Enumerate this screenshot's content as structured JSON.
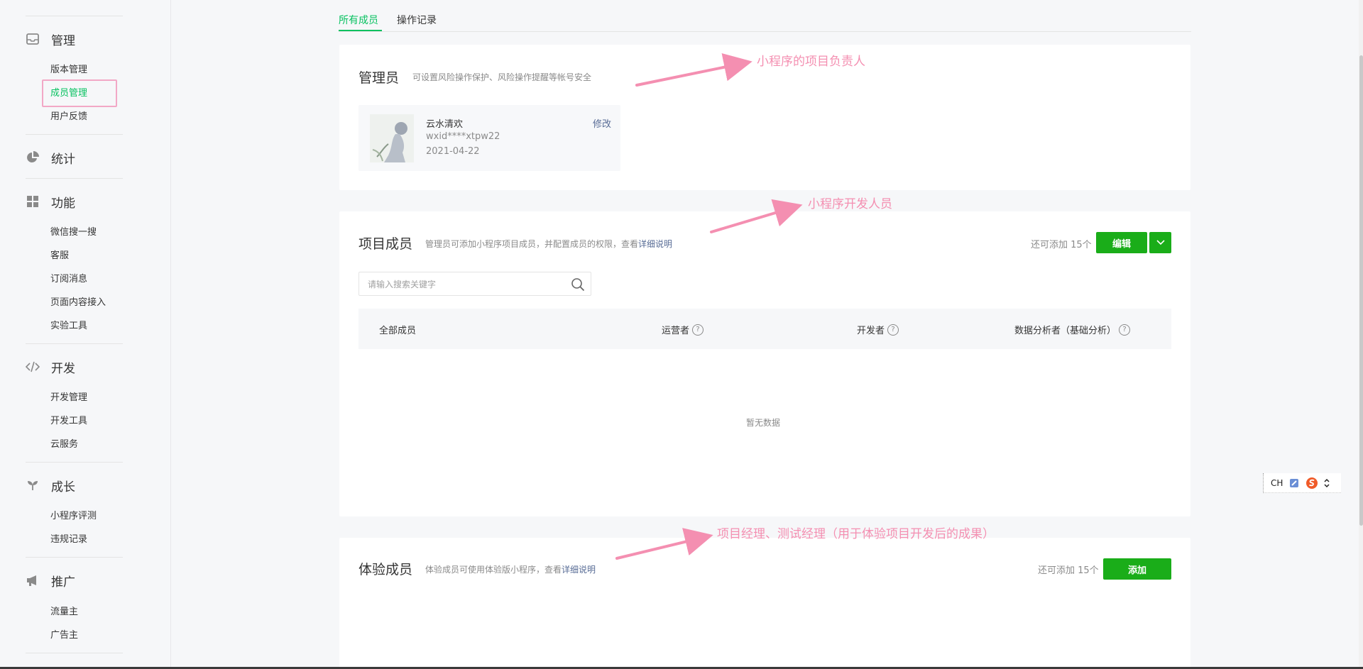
{
  "sidebar": {
    "groups": [
      {
        "label": "管理",
        "icon": "inbox-icon"
      },
      {
        "label": "统计",
        "icon": "pie-chart-icon"
      },
      {
        "label": "功能",
        "icon": "grid-icon"
      },
      {
        "label": "开发",
        "icon": "code-icon"
      },
      {
        "label": "成长",
        "icon": "sprout-icon"
      },
      {
        "label": "推广",
        "icon": "megaphone-icon"
      }
    ],
    "manage_items": [
      "版本管理",
      "成员管理",
      "用户反馈"
    ],
    "feature_items": [
      "微信搜一搜",
      "客服",
      "订阅消息",
      "页面内容接入",
      "实验工具"
    ],
    "dev_items": [
      "开发管理",
      "开发工具",
      "云服务"
    ],
    "growth_items": [
      "小程序评测",
      "违规记录"
    ],
    "promo_items": [
      "流量主",
      "广告主"
    ]
  },
  "tabs": [
    "所有成员",
    "操作记录"
  ],
  "admin": {
    "title": "管理员",
    "subtitle": "可设置风险操作保护、风险操作提醒等帐号安全",
    "name": "云水清欢",
    "id": "wxid****xtpw22",
    "date": "2021-04-22",
    "edit_label": "修改"
  },
  "project": {
    "title": "项目成员",
    "subtitle": "管理员可添加小程序项目成员，并配置成员的权限，查看",
    "link": "详细说明",
    "remaining": "还可添加 15个",
    "edit_button": "编辑",
    "search_placeholder": "请输入搜索关键字",
    "columns": [
      "全部成员",
      "运营者",
      "开发者",
      "数据分析者（基础分析）"
    ],
    "empty": "暂无数据"
  },
  "experience": {
    "title": "体验成员",
    "subtitle": "体验成员可使用体验版小程序，查看",
    "link": "详细说明",
    "remaining": "还可添加 15个",
    "add_button": "添加"
  },
  "annotations": {
    "admin_note": "小程序的项目负责人",
    "project_note": "小程序开发人员",
    "experience_note": "项目经理、测试经理（用于体验项目开发后的成果）"
  },
  "ime": {
    "label": "CH"
  },
  "colors": {
    "accent": "#07c160",
    "button": "#1aad19",
    "annotation": "#f48fb1",
    "link": "#576b95"
  }
}
